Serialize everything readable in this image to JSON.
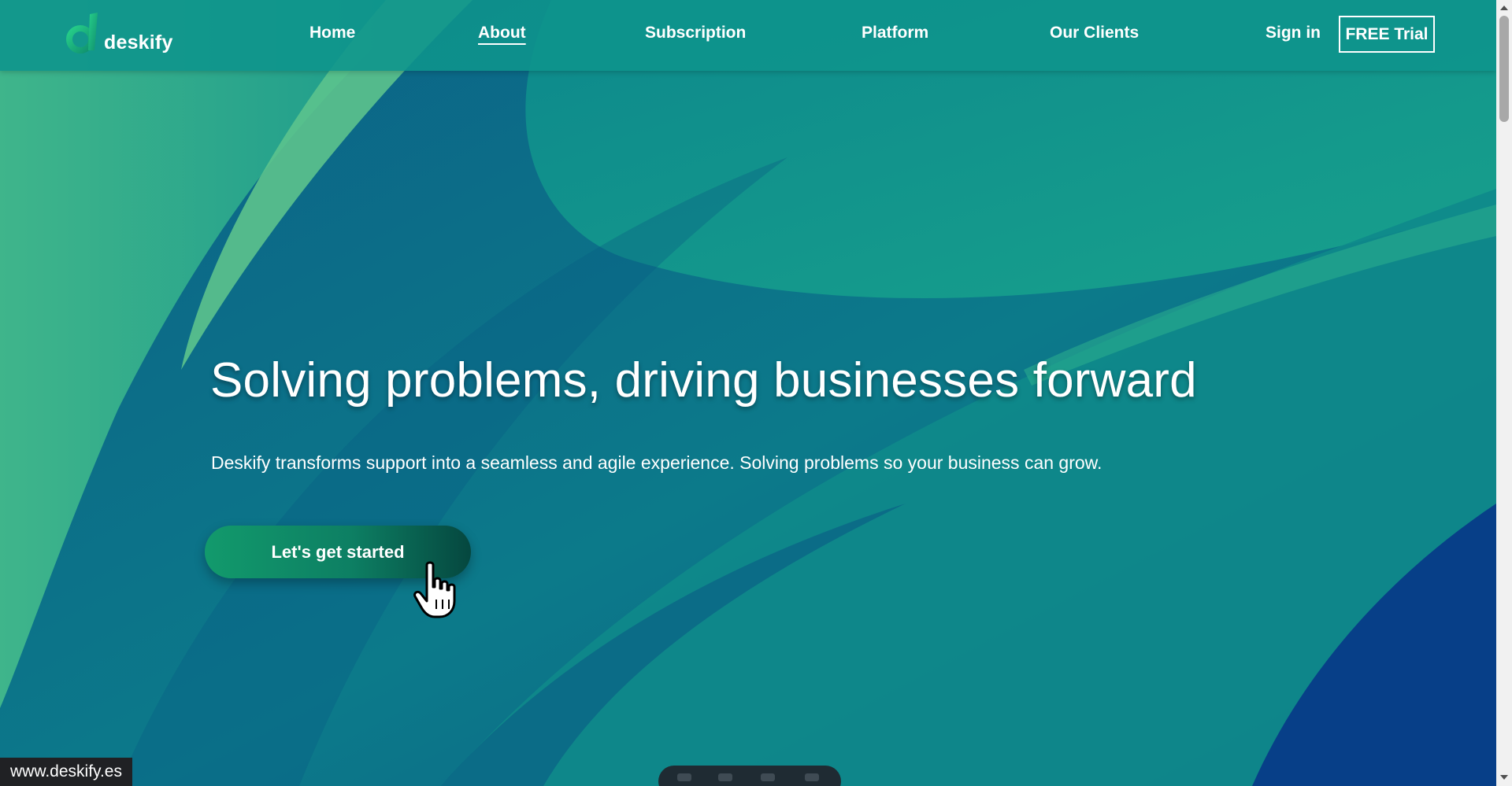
{
  "brand": {
    "name": "deskify",
    "logo_icon": "deskify-d-logo",
    "accent": "#17b57a"
  },
  "nav": {
    "items": [
      {
        "label": "Home"
      },
      {
        "label": "About"
      },
      {
        "label": "Subscription"
      },
      {
        "label": "Platform"
      },
      {
        "label": "Our Clients"
      }
    ],
    "active": "About",
    "sign_in": "Sign in",
    "trial": "FREE Trial"
  },
  "hero": {
    "title": "Solving problems, driving businesses forward",
    "subtitle": "Deskify transforms support into a seamless and agile experience. Solving problems so your business can grow.",
    "cta": "Let's get started"
  },
  "status_bar": {
    "url": "www.deskify.es"
  },
  "colors": {
    "header_bg": "#0e948c",
    "hero_deep": "#0b6a86",
    "hero_teal": "#13a18e",
    "cta_start": "#129a6c",
    "cta_end": "#05473f"
  }
}
